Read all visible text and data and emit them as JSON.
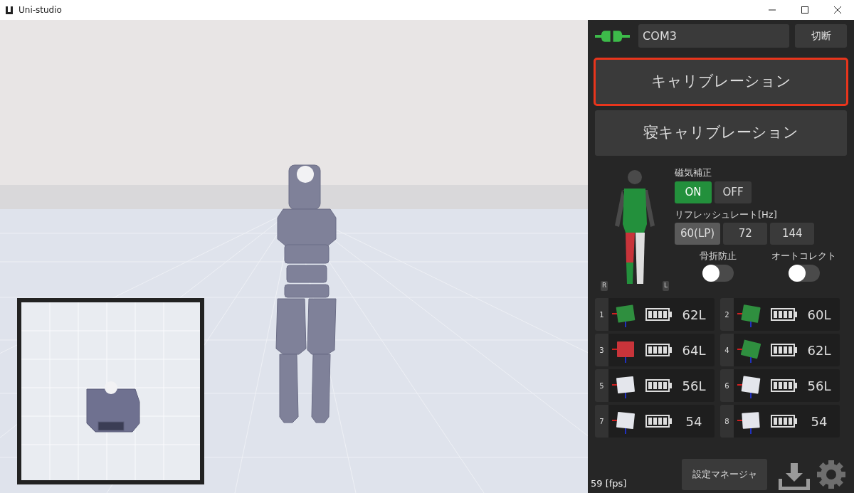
{
  "window": {
    "title": "Uni-studio"
  },
  "connection": {
    "port": "COM3",
    "connected": true,
    "disconnect_label": "切断"
  },
  "calibration_buttons": [
    {
      "label": "キャリブレーション",
      "highlighted": true
    },
    {
      "label": "寝キャリブレーション",
      "highlighted": false
    }
  ],
  "body_map": {
    "side_labels": [
      "R",
      "L"
    ]
  },
  "magnetic_correction": {
    "label": "磁気補正",
    "options": [
      {
        "label": "ON",
        "selected": true
      },
      {
        "label": "OFF",
        "selected": false
      }
    ]
  },
  "refresh_rate": {
    "label": "リフレッシュレート[Hz]",
    "options": [
      {
        "label": "60(LP)",
        "selected": true
      },
      {
        "label": "72",
        "selected": false
      },
      {
        "label": "144",
        "selected": false
      }
    ]
  },
  "toggles": [
    {
      "label": "骨折防止",
      "on": false
    },
    {
      "label": "オートコレクト",
      "on": false
    }
  ],
  "sensors": [
    {
      "number": "1",
      "color": "#2f8f3f",
      "reading": "62L"
    },
    {
      "number": "2",
      "color": "#2f8f3f",
      "reading": "60L"
    },
    {
      "number": "3",
      "color": "#c8343a",
      "reading": "64L"
    },
    {
      "number": "4",
      "color": "#2f8f3f",
      "reading": "62L"
    },
    {
      "number": "5",
      "color": "#e4e6ec",
      "reading": "56L"
    },
    {
      "number": "6",
      "color": "#e4e6ec",
      "reading": "56L"
    },
    {
      "number": "7",
      "color": "#e4e6ec",
      "reading": "54"
    },
    {
      "number": "8",
      "color": "#e4e6ec",
      "reading": "54"
    }
  ],
  "footer": {
    "settings_manager": "設定マネージャ",
    "fps": "59 [fps]"
  }
}
